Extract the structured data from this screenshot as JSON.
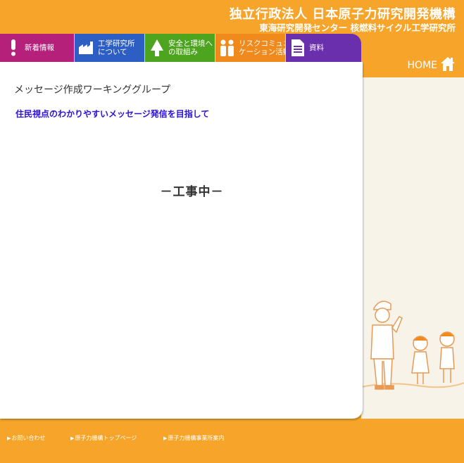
{
  "header": {
    "title": "独立行政法人 日本原子力研究開発機構",
    "subtitle": "東海研究開発センター 核燃料サイクル工学研究所"
  },
  "nav": [
    {
      "label": "新着情報",
      "icon": "exclamation-icon",
      "color": "#b5217a"
    },
    {
      "label": "工学研究所\nについて",
      "line1": "工学研究所",
      "line2": "について",
      "icon": "factory-icon",
      "color": "#2d5ec4"
    },
    {
      "label": "安全と環境への取組み",
      "line1": "安全と環境へ",
      "line2": "の取組み",
      "icon": "tree-icon",
      "color": "#4da51f"
    },
    {
      "label": "リスクコミュニケーション活動",
      "line1": "リスクコミュニ",
      "line2": "ケーション活動",
      "icon": "people-icon",
      "color": "#f08a1c"
    },
    {
      "label": "資料",
      "icon": "document-icon",
      "color": "#6a2fad"
    }
  ],
  "home": {
    "label": "HOME"
  },
  "main": {
    "title": "メッセージ作成ワーキンググループ",
    "subtitle": "住民視点のわかりやすいメッセージ発信を目指して",
    "status": "－工事中－"
  },
  "footer": {
    "links": [
      "お問い合わせ",
      "原子力機構トップページ",
      "原子力機構事業所案内"
    ]
  },
  "colors": {
    "background": "#f6a52a",
    "content": "#ffffff",
    "side_panel": "#f7f3e9",
    "subtitle_text": "#2a10e0"
  }
}
